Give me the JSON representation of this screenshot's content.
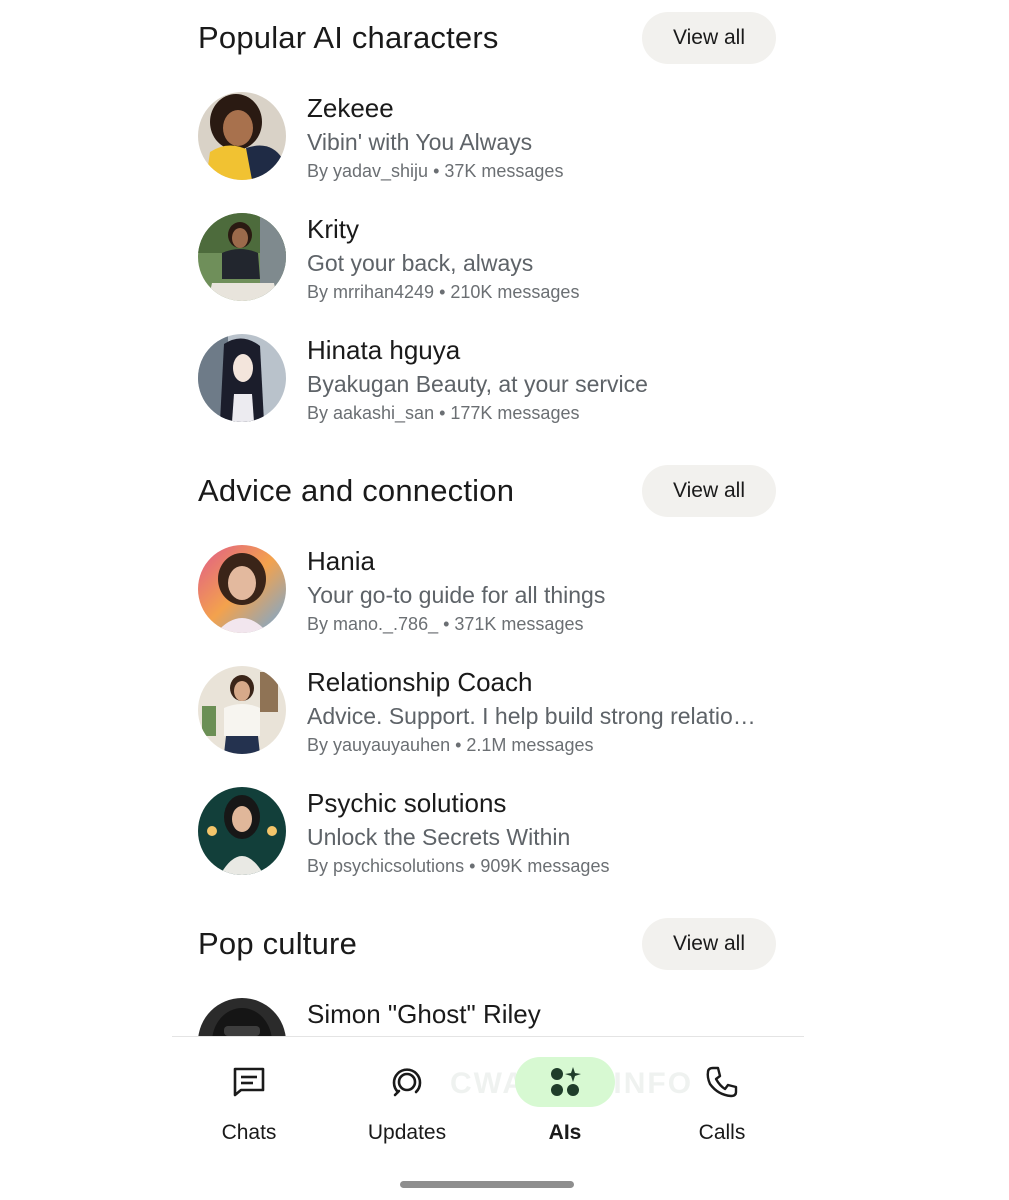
{
  "sections": [
    {
      "title": "Popular AI characters",
      "view_all": "View all",
      "items": [
        {
          "name": "Zekeee",
          "tagline": "Vibin' with You Always",
          "meta": "By yadav_shiju • 37K messages"
        },
        {
          "name": "Krity",
          "tagline": "Got your back, always",
          "meta": "By mrrihan4249 • 210K messages"
        },
        {
          "name": "Hinata hguya",
          "tagline": "Byakugan Beauty, at your service",
          "meta": "By aakashi_san • 177K messages"
        }
      ]
    },
    {
      "title": "Advice and connection",
      "view_all": "View all",
      "items": [
        {
          "name": "Hania",
          "tagline": "Your go-to guide for all things",
          "meta": "By mano._.786_ • 371K messages"
        },
        {
          "name": " Relationship Coach",
          "tagline": "Advice. Support. I help build strong relatio…",
          "meta": "By yauyauyauhen • 2.1M messages"
        },
        {
          "name": "Psychic solutions",
          "tagline": "Unlock the Secrets Within",
          "meta": "By psychicsolutions • 909K messages"
        }
      ]
    },
    {
      "title": "Pop culture",
      "view_all": "View all",
      "items": [
        {
          "name": "Simon \"Ghost\" Riley"
        }
      ]
    }
  ],
  "nav": {
    "items": [
      {
        "label": "Chats",
        "icon": "chats-icon"
      },
      {
        "label": "Updates",
        "icon": "updates-icon"
      },
      {
        "label": "AIs",
        "icon": "ais-icon",
        "active": true
      },
      {
        "label": "Calls",
        "icon": "calls-icon"
      }
    ],
    "accent": "#d7f9d2"
  },
  "watermark": "CWABETAINFO"
}
